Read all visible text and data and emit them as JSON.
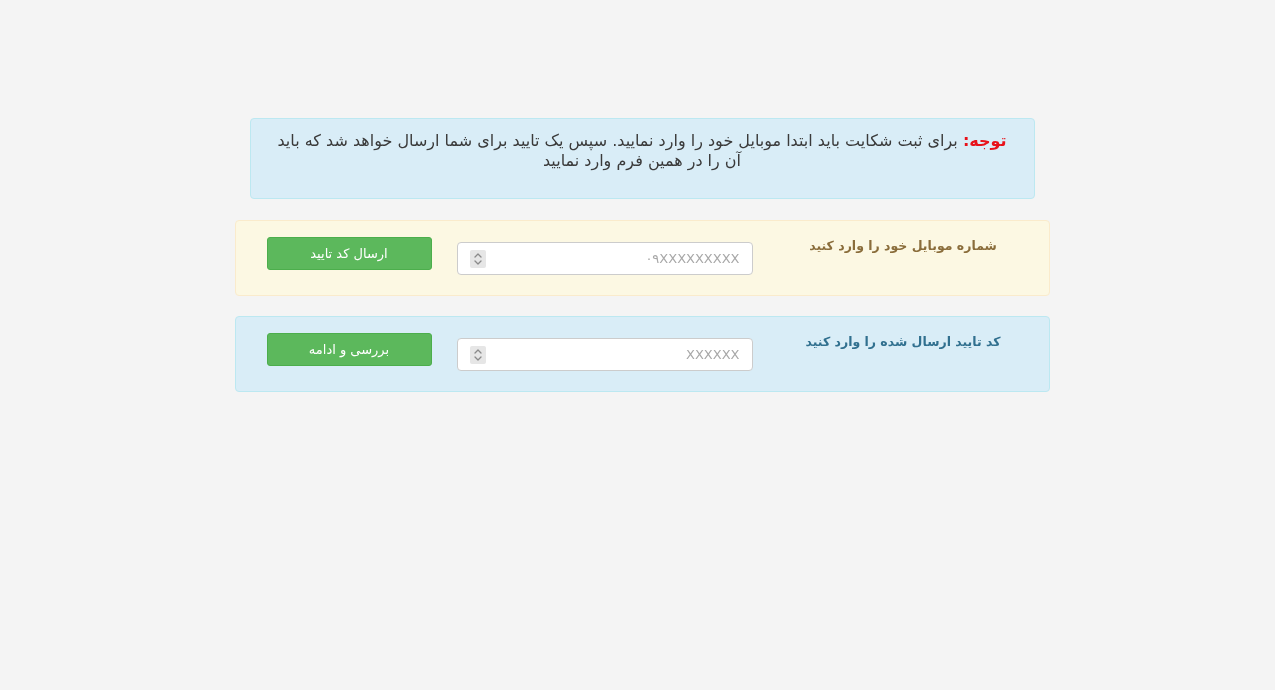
{
  "notice": {
    "text": "**توجه:** برای ثبت شکایت باید ابتدا موبایل خود را وارد نمایید. سپس یک تایید برای شما ارسال خواهد شد که باید آن را در همین فرم وارد نمایید"
  },
  "steps": [
    {
      "kind": "warning",
      "label": "شماره موبایل خود را وارد کنید",
      "placeholder": "۰۹XXXXXXXXX",
      "button": "ارسال کد تایید"
    },
    {
      "kind": "info",
      "label": "کد تایید ارسال شده را وارد کنید",
      "placeholder": "XXXXXX",
      "button": "بررسی و ادامه"
    }
  ]
}
